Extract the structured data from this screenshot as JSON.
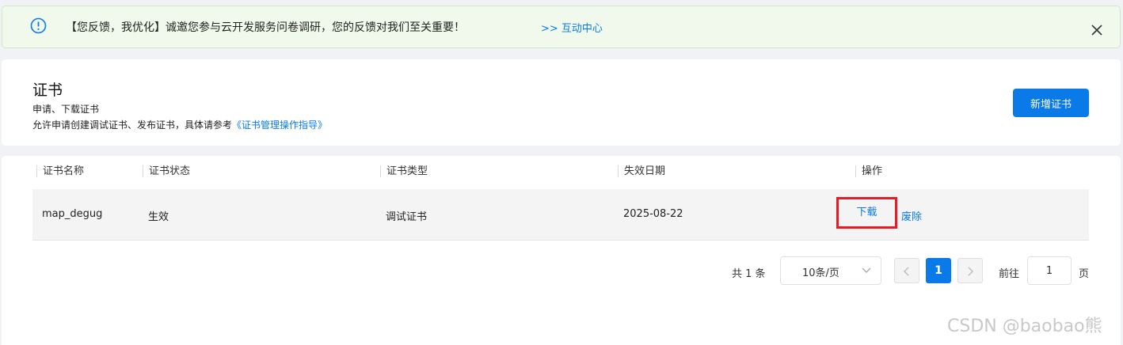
{
  "banner": {
    "message": "【您反馈，我优化】诚邀您参与云开发服务问卷调研，您的反馈对我们至关重要！",
    "link": ">> 互动中心"
  },
  "header": {
    "title": "证书",
    "subtitle": "申请、下载证书",
    "description_prefix": "允许申请创建调试证书、发布证书，具体请参考",
    "guide_link": "《证书管理操作指导》",
    "add_button": "新增证书"
  },
  "table": {
    "columns": [
      "证书名称",
      "证书状态",
      "证书类型",
      "失效日期",
      "操作"
    ],
    "rows": [
      {
        "name": "map_degug",
        "status": "生效",
        "type": "调试证书",
        "expiry": "2025-08-22",
        "actions": [
          "下载",
          "废除"
        ]
      }
    ]
  },
  "pagination": {
    "total": "共 1 条",
    "page_size": "10条/页",
    "current_page": "1",
    "goto_label": "前往",
    "goto_value": "1",
    "page_unit": "页"
  },
  "watermark": "CSDN @baobao熊",
  "colors": {
    "accent": "#0a7ae8",
    "banner_bg": "#f0f9eb",
    "highlight_border": "#e41c25"
  }
}
